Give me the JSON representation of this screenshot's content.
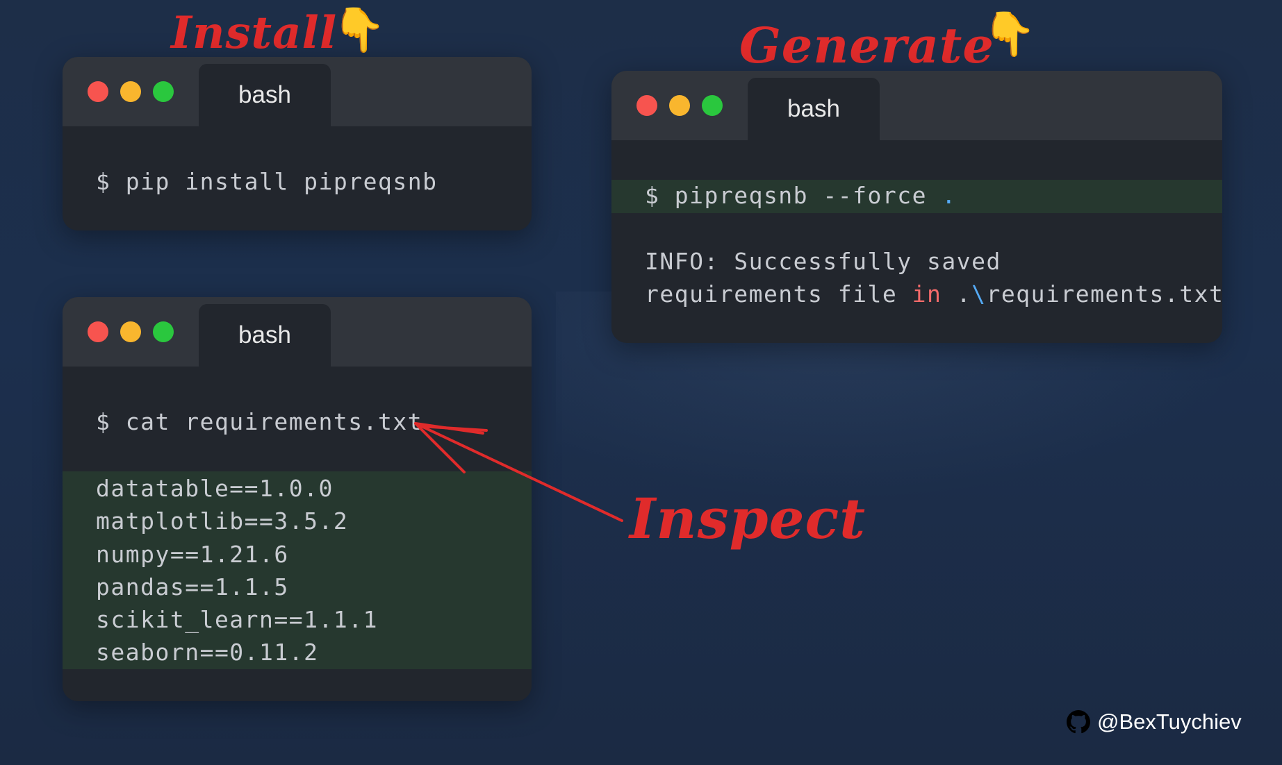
{
  "annotations": {
    "install": "Install",
    "generate": "Generate",
    "inspect": "Inspect"
  },
  "windows": {
    "install": {
      "tab": "bash",
      "command": "$ pip install pipreqsnb"
    },
    "generate": {
      "tab": "bash",
      "command_prefix": "$ pipreqsnb --force",
      "command_dot": ".",
      "output_line1": "INFO: Successfully saved",
      "output_line2_a": "requirements file",
      "output_line2_kw": "in",
      "output_line2_b": ".\\",
      "output_line2_c": "requirements.txt"
    },
    "inspect": {
      "tab": "bash",
      "command": "$ cat requirements.txt",
      "requirements": [
        "datatable==1.0.0",
        "matplotlib==3.5.2",
        "numpy==1.21.6",
        "pandas==1.1.5",
        "scikit_learn==1.1.1",
        "seaborn==0.11.2"
      ]
    }
  },
  "credit": {
    "handle": "@BexTuychiev",
    "icon": "github-icon"
  },
  "colors": {
    "annotation": "#e02b2b",
    "terminal_bg": "#22262d",
    "titlebar_bg": "#31353c",
    "highlight_bg": "#26382f",
    "dot_red": "#f7544f",
    "dot_yellow": "#f9b62e",
    "dot_green": "#2ac73e"
  }
}
